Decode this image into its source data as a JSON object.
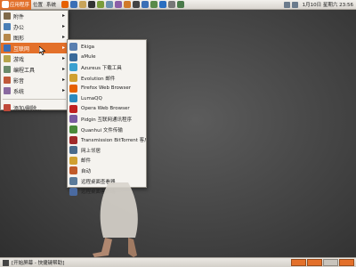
{
  "top_panel": {
    "menu_button": "应用程序",
    "places_button": "位置",
    "system_button": "系统",
    "clock": "1月10日 星期六 23:56",
    "launchers": [
      {
        "icon": "firefox-icon",
        "color": "#e66000"
      },
      {
        "icon": "help-icon",
        "color": "#3b6fb6"
      },
      {
        "icon": "home-folder-icon",
        "color": "#c8a45a"
      },
      {
        "icon": "terminal-icon",
        "color": "#333333"
      },
      {
        "icon": "text-editor-icon",
        "color": "#7a9c3a"
      },
      {
        "icon": "image-viewer-icon",
        "color": "#6a8fb0"
      },
      {
        "icon": "pidgin-icon",
        "color": "#8b5fa8"
      },
      {
        "icon": "music-player-icon",
        "color": "#d07a2a"
      },
      {
        "icon": "video-icon",
        "color": "#444444"
      },
      {
        "icon": "mail-icon",
        "color": "#3b6fb6"
      },
      {
        "icon": "ftp-icon",
        "color": "#5a8a4a"
      },
      {
        "icon": "qq-icon",
        "color": "#2a6ec0"
      },
      {
        "icon": "camera-icon",
        "color": "#777777"
      },
      {
        "icon": "system-monitor-icon",
        "color": "#4a7a4a"
      }
    ]
  },
  "main_menu": {
    "items": [
      {
        "label": "附件",
        "icon": "accessories-icon",
        "color": "#7f6a4a",
        "has_arrow": true
      },
      {
        "label": "办公",
        "icon": "office-icon",
        "color": "#4a7fb6",
        "has_arrow": true
      },
      {
        "label": "图形",
        "icon": "graphics-icon",
        "color": "#b6884a",
        "has_arrow": true
      },
      {
        "label": "互联网",
        "icon": "internet-icon",
        "color": "#3b6fb6",
        "has_arrow": true,
        "active": true
      },
      {
        "label": "游戏",
        "icon": "games-icon",
        "color": "#b6a44a",
        "has_arrow": true
      },
      {
        "label": "编程工具",
        "icon": "programming-icon",
        "color": "#6a8a6a",
        "has_arrow": true
      },
      {
        "label": "影音",
        "icon": "sound-video-icon",
        "color": "#c05a3a",
        "has_arrow": true
      },
      {
        "label": "系统",
        "icon": "system-tools-icon",
        "color": "#8a6aa0",
        "has_arrow": true
      }
    ],
    "footer_item": {
      "label": "添加/删除...",
      "icon": "add-remove-icon",
      "color": "#c04a3a"
    }
  },
  "internet_submenu": {
    "items": [
      {
        "label": "Ekiga",
        "icon": "ekiga-icon",
        "color": "#5a7fb0"
      },
      {
        "label": "aMule",
        "icon": "amule-icon",
        "color": "#3a6a9a"
      },
      {
        "label": "Azureus 下载工具",
        "icon": "azureus-icon",
        "color": "#3aa0d0"
      },
      {
        "label": "Evolution 邮件",
        "icon": "evolution-icon",
        "color": "#d0a030"
      },
      {
        "label": "Firefox Web Browser",
        "icon": "firefox-icon",
        "color": "#e66000"
      },
      {
        "label": "LumaQQ",
        "icon": "lumaqq-icon",
        "color": "#2a8ac0"
      },
      {
        "label": "Opera Web Browser",
        "icon": "opera-icon",
        "color": "#c02020"
      },
      {
        "label": "Pidgin 互联网通讯程序",
        "icon": "pidgin-icon",
        "color": "#7a5aa0"
      },
      {
        "label": "Quanhui 文件传输",
        "icon": "ftp-icon",
        "color": "#4a8a3a"
      },
      {
        "label": "Transmission BitTorrent 客户端",
        "icon": "transmission-icon",
        "color": "#a02a2a"
      },
      {
        "label": "网上邻居",
        "icon": "network-icon",
        "color": "#4a6a8a"
      },
      {
        "label": "邮件",
        "icon": "mail-icon",
        "color": "#d0a030"
      },
      {
        "label": "自动",
        "icon": "auto-icon",
        "color": "#c05a2a"
      },
      {
        "label": "远程桌面查看器",
        "icon": "remote-desktop-icon",
        "color": "#5a7a9a"
      },
      {
        "label": "远程桌面客户端",
        "icon": "terminal-server-icon",
        "color": "#4a6aa0"
      }
    ]
  },
  "bottom_panel": {
    "task_label": "[开始屏幕 - 快捷键帮助]",
    "workspaces": [
      true,
      true,
      false,
      true
    ]
  },
  "colors": {
    "accent": "#e3702a",
    "menu_bg": "#f5f3ef"
  }
}
